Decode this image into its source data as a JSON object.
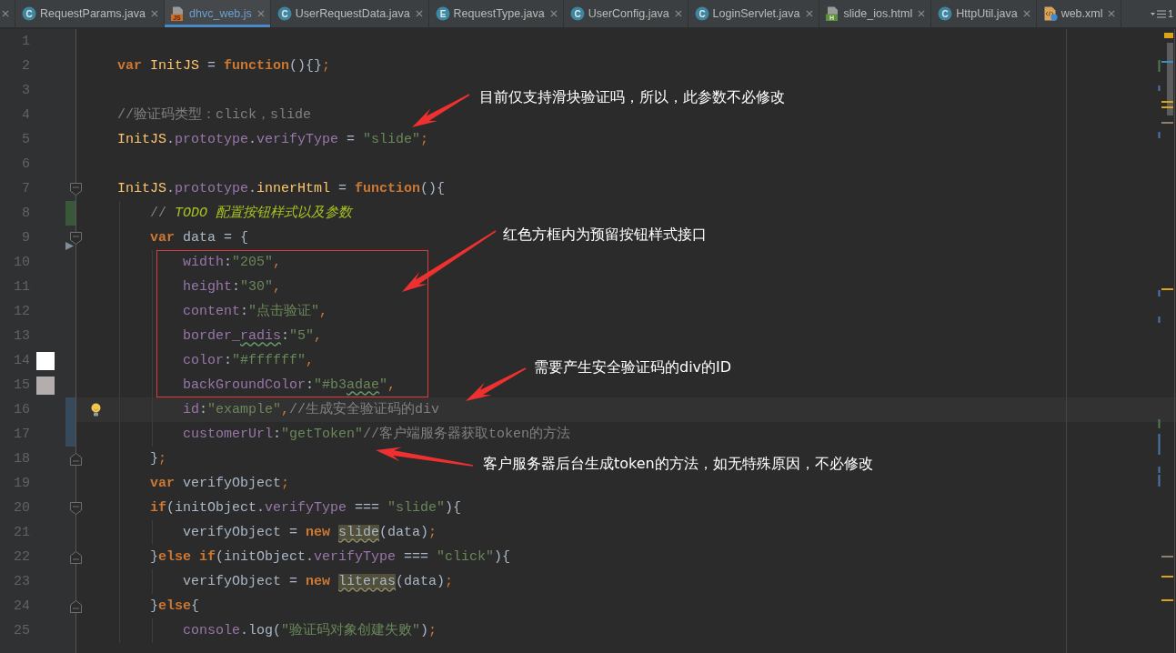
{
  "tabs": [
    {
      "label": "RequestParams.java",
      "kind": "class",
      "icon_text": "C",
      "selected": false,
      "modified": false
    },
    {
      "label": "dhvc_web.js",
      "kind": "js",
      "icon_text": "JS",
      "selected": true,
      "modified": true
    },
    {
      "label": "UserRequestData.java",
      "kind": "class",
      "icon_text": "C",
      "selected": false,
      "modified": false
    },
    {
      "label": "RequestType.java",
      "kind": "enum",
      "icon_text": "E",
      "selected": false,
      "modified": false
    },
    {
      "label": "UserConfig.java",
      "kind": "class",
      "icon_text": "C",
      "selected": false,
      "modified": false
    },
    {
      "label": "LoginServlet.java",
      "kind": "class",
      "icon_text": "C",
      "selected": false,
      "modified": false
    },
    {
      "label": "slide_ios.html",
      "kind": "html",
      "icon_text": "H",
      "selected": false,
      "modified": false
    },
    {
      "label": "HttpUtil.java",
      "kind": "class",
      "icon_text": "C",
      "selected": false,
      "modified": false
    },
    {
      "label": "web.xml",
      "kind": "xml",
      "selected": false,
      "modified": false
    }
  ],
  "tab_overflow": {
    "count": "1"
  },
  "editor": {
    "lines": [
      {
        "number": "1"
      },
      {
        "number": "2",
        "tokens": [
          {
            "text": "var ",
            "kind": "kw"
          },
          {
            "text": "InitJS",
            "kind": "global"
          },
          {
            "text": " = ",
            "kind": "plain"
          },
          {
            "text": "function",
            "kind": "kw"
          },
          {
            "text": "(){}",
            "kind": "plain"
          },
          {
            "text": ";",
            "kind": "punct"
          }
        ]
      },
      {
        "number": "3"
      },
      {
        "number": "4",
        "tokens": [
          {
            "text": "//验证码类型：click，slide",
            "kind": "comment"
          }
        ]
      },
      {
        "number": "5",
        "tokens": [
          {
            "text": "InitJS",
            "kind": "global"
          },
          {
            "text": ".",
            "kind": "plain"
          },
          {
            "text": "prototype",
            "kind": "prop"
          },
          {
            "text": ".",
            "kind": "plain"
          },
          {
            "text": "verifyType",
            "kind": "prop"
          },
          {
            "text": " = ",
            "kind": "plain"
          },
          {
            "text": "\"slide\"",
            "kind": "str"
          },
          {
            "text": ";",
            "kind": "punct"
          }
        ]
      },
      {
        "number": "6"
      },
      {
        "number": "7",
        "fold_start": true,
        "tokens": [
          {
            "text": "InitJS",
            "kind": "global"
          },
          {
            "text": ".",
            "kind": "plain"
          },
          {
            "text": "prototype",
            "kind": "prop"
          },
          {
            "text": ".",
            "kind": "plain"
          },
          {
            "text": "innerHtml",
            "kind": "global"
          },
          {
            "text": " = ",
            "kind": "plain"
          },
          {
            "text": "function",
            "kind": "kw"
          },
          {
            "text": "(){",
            "kind": "plain"
          }
        ],
        "children": [
          {
            "number": "8",
            "added": true,
            "tokens": [
              {
                "text": "// ",
                "kind": "comment"
              },
              {
                "text": "TODO 配置按钮样式以及参数",
                "kind": "todo"
              }
            ]
          },
          {
            "number": "9",
            "fold_start": true,
            "gutter_arrow": true,
            "tokens": [
              {
                "text": "var",
                "kind": "kw"
              },
              {
                "text": " data = {",
                "kind": "plain"
              }
            ],
            "children": [
              {
                "number": "10",
                "tokens": [
                  {
                    "text": "width",
                    "kind": "prop"
                  },
                  {
                    "text": ":",
                    "kind": "plain"
                  },
                  {
                    "text": "\"205\"",
                    "kind": "str"
                  },
                  {
                    "text": ",",
                    "kind": "punct"
                  }
                ]
              },
              {
                "number": "11",
                "tokens": [
                  {
                    "text": "height",
                    "kind": "prop"
                  },
                  {
                    "text": ":",
                    "kind": "plain"
                  },
                  {
                    "text": "\"30\"",
                    "kind": "str"
                  },
                  {
                    "text": ",",
                    "kind": "punct"
                  }
                ]
              },
              {
                "number": "12",
                "tokens": [
                  {
                    "text": "content",
                    "kind": "prop"
                  },
                  {
                    "text": ":",
                    "kind": "plain"
                  },
                  {
                    "text": "\"点击验证\"",
                    "kind": "str"
                  },
                  {
                    "text": ",",
                    "kind": "punct"
                  }
                ]
              },
              {
                "number": "13",
                "tokens": [
                  {
                    "text": "border_",
                    "kind": "prop"
                  },
                  {
                    "text": "radis",
                    "kind": "prop",
                    "typo": true
                  },
                  {
                    "text": ":",
                    "kind": "plain"
                  },
                  {
                    "text": "\"5\"",
                    "kind": "str"
                  },
                  {
                    "text": ",",
                    "kind": "punct"
                  }
                ]
              },
              {
                "number": "14",
                "color": "#ffffff",
                "tokens": [
                  {
                    "text": "color",
                    "kind": "prop"
                  },
                  {
                    "text": ":",
                    "kind": "plain"
                  },
                  {
                    "text": "\"#ffffff\"",
                    "kind": "str"
                  },
                  {
                    "text": ",",
                    "kind": "punct"
                  }
                ]
              },
              {
                "number": "15",
                "color": "#b3adae",
                "tokens": [
                  {
                    "text": "backGroundColor",
                    "kind": "prop"
                  },
                  {
                    "text": ":",
                    "kind": "plain"
                  },
                  {
                    "text": "\"#b3",
                    "kind": "str"
                  },
                  {
                    "text": "adae",
                    "kind": "str",
                    "typo": true
                  },
                  {
                    "text": "\"",
                    "kind": "str"
                  },
                  {
                    "text": ",",
                    "kind": "punct"
                  }
                ]
              },
              {
                "number": "16",
                "modified": true,
                "current": true,
                "bulb": true,
                "tokens": [
                  {
                    "text": "id",
                    "kind": "prop"
                  },
                  {
                    "text": ":",
                    "kind": "plain"
                  },
                  {
                    "text": "\"example\"",
                    "kind": "str"
                  },
                  {
                    "text": ",",
                    "kind": "punct"
                  },
                  {
                    "text": "//生成安全验证码的div",
                    "kind": "comment"
                  }
                ]
              },
              {
                "number": "17",
                "modified": true,
                "tokens": [
                  {
                    "text": "customerUrl",
                    "kind": "prop"
                  },
                  {
                    "text": ":",
                    "kind": "plain"
                  },
                  {
                    "text": "\"getToken\"",
                    "kind": "str"
                  },
                  {
                    "text": "//客户端服务器获取token的方法",
                    "kind": "comment"
                  }
                ]
              }
            ]
          },
          {
            "number": "18",
            "fold_end": true,
            "tokens": [
              {
                "text": "}",
                "kind": "plain"
              },
              {
                "text": ";",
                "kind": "punct"
              }
            ]
          },
          {
            "number": "19",
            "tokens": [
              {
                "text": "var",
                "kind": "kw"
              },
              {
                "text": " verifyObject",
                "kind": "plain"
              },
              {
                "text": ";",
                "kind": "punct"
              }
            ]
          },
          {
            "number": "20",
            "fold_start": true,
            "tokens": [
              {
                "text": "if",
                "kind": "kw"
              },
              {
                "text": "(initObject.",
                "kind": "plain"
              },
              {
                "text": "verifyType",
                "kind": "prop"
              },
              {
                "text": " === ",
                "kind": "plain"
              },
              {
                "text": "\"slide\"",
                "kind": "str"
              },
              {
                "text": "){",
                "kind": "plain"
              }
            ],
            "children": [
              {
                "number": "21",
                "tokens": [
                  {
                    "text": "verifyObject = ",
                    "kind": "plain"
                  },
                  {
                    "text": "new ",
                    "kind": "kw"
                  },
                  {
                    "text": "slide",
                    "kind": "plain",
                    "warning": true
                  },
                  {
                    "text": "(data)",
                    "kind": "plain"
                  },
                  {
                    "text": ";",
                    "kind": "punct"
                  }
                ]
              }
            ]
          },
          {
            "number": "22",
            "fold_end": true,
            "tokens": [
              {
                "text": "}",
                "kind": "plain"
              },
              {
                "text": "else if",
                "kind": "kw"
              },
              {
                "text": "(initObject.",
                "kind": "plain"
              },
              {
                "text": "verifyType",
                "kind": "prop"
              },
              {
                "text": " === ",
                "kind": "plain"
              },
              {
                "text": "\"click\"",
                "kind": "str"
              },
              {
                "text": "){",
                "kind": "plain"
              }
            ],
            "children": [
              {
                "number": "23",
                "tokens": [
                  {
                    "text": "verifyObject = ",
                    "kind": "plain"
                  },
                  {
                    "text": "new ",
                    "kind": "kw"
                  },
                  {
                    "text": "literas",
                    "kind": "plain",
                    "warning": true
                  },
                  {
                    "text": "(data)",
                    "kind": "plain"
                  },
                  {
                    "text": ";",
                    "kind": "punct"
                  }
                ]
              }
            ]
          },
          {
            "number": "24",
            "fold_end": true,
            "tokens": [
              {
                "text": "}",
                "kind": "plain"
              },
              {
                "text": "else",
                "kind": "kw"
              },
              {
                "text": "{",
                "kind": "plain"
              }
            ],
            "children": [
              {
                "number": "25",
                "tokens": [
                  {
                    "text": "console",
                    "kind": "prop"
                  },
                  {
                    "text": ".",
                    "kind": "plain"
                  },
                  {
                    "text": "log",
                    "kind": "plain"
                  },
                  {
                    "text": "(",
                    "kind": "plain"
                  },
                  {
                    "text": "\"验证码对象创建失败\"",
                    "kind": "str"
                  },
                  {
                    "text": ")",
                    "kind": "plain"
                  },
                  {
                    "text": ";",
                    "kind": "punct"
                  }
                ]
              }
            ]
          }
        ]
      }
    ]
  },
  "annotations": [
    {
      "text": "目前仅支持滑块验证吗，所以，此参数不必修改"
    },
    {
      "text": "红色方框内为预留按钮样式接口"
    },
    {
      "text": "需要产生安全验证码的div的ID"
    },
    {
      "text": "客户服务器后台生成token的方法，如无特殊原因，不必修改"
    }
  ]
}
